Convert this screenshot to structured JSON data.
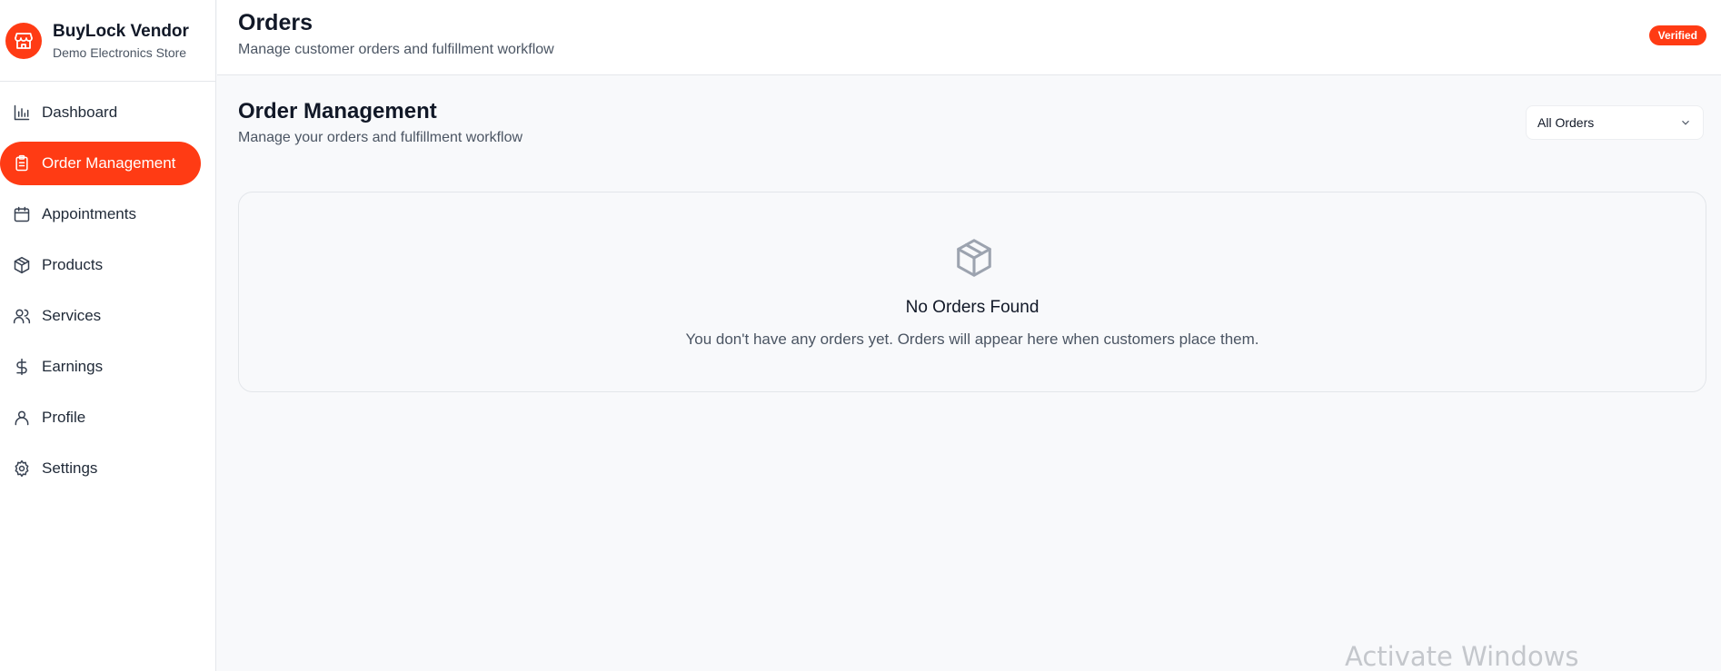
{
  "brand": {
    "name": "BuyLock Vendor",
    "subtitle": "Demo Electronics Store",
    "icon": "store-icon"
  },
  "sidebar": {
    "items": [
      {
        "label": "Dashboard",
        "icon": "bar-chart-icon",
        "active": false
      },
      {
        "label": "Order Management",
        "icon": "clipboard-icon",
        "active": true
      },
      {
        "label": "Appointments",
        "icon": "calendar-icon",
        "active": false
      },
      {
        "label": "Products",
        "icon": "package-icon",
        "active": false
      },
      {
        "label": "Services",
        "icon": "users-icon",
        "active": false
      },
      {
        "label": "Earnings",
        "icon": "dollar-icon",
        "active": false
      },
      {
        "label": "Profile",
        "icon": "user-icon",
        "active": false
      },
      {
        "label": "Settings",
        "icon": "gear-icon",
        "active": false
      }
    ]
  },
  "header": {
    "title": "Orders",
    "subtitle": "Manage customer orders and fulfillment workflow",
    "badge": "Verified"
  },
  "main": {
    "title": "Order Management",
    "subtitle": "Manage your orders and fulfillment workflow",
    "filter": {
      "selected": "All Orders"
    },
    "empty": {
      "icon": "package-icon",
      "title": "No Orders Found",
      "text": "You don't have any orders yet. Orders will appear here when customers place them."
    }
  },
  "watermark": "Activate Windows",
  "colors": {
    "accent": "#ff3b14",
    "background": "#f8f9fb"
  }
}
